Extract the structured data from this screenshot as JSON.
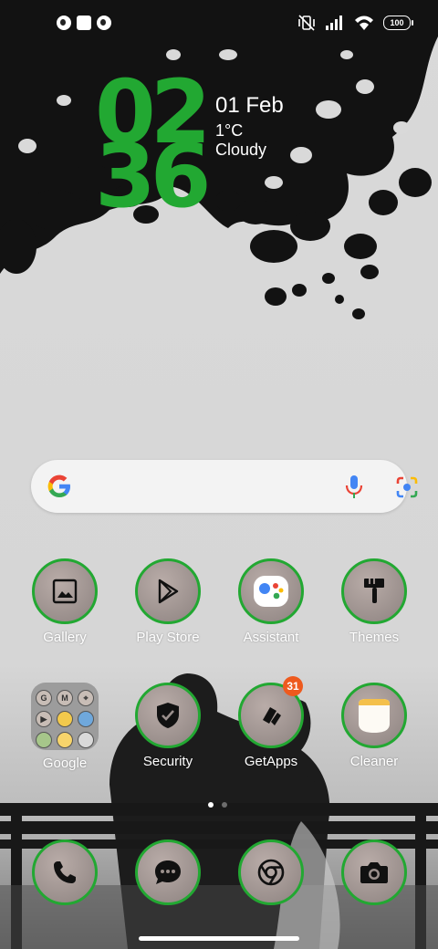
{
  "status_bar": {
    "battery": "100",
    "left_icons": [
      "app-notification-icon",
      "square-notification-icon",
      "app-notification-icon"
    ],
    "right_icons": [
      "vibrate-off-icon",
      "signal-icon",
      "wifi-icon",
      "battery-icon"
    ]
  },
  "clock": {
    "hours": "02",
    "minutes": "36",
    "date": "01 Feb",
    "temperature": "1°C",
    "weather": "Cloudy",
    "accent_color": "#22a832"
  },
  "search": {
    "icons": [
      "google-g-icon",
      "mic-icon",
      "lens-icon"
    ]
  },
  "apps_row1": [
    {
      "label": "Gallery",
      "icon": "gallery-icon"
    },
    {
      "label": "Play Store",
      "icon": "play-store-icon"
    },
    {
      "label": "Assistant",
      "icon": "assistant-icon"
    },
    {
      "label": "Themes",
      "icon": "brush-icon"
    }
  ],
  "apps_row2": [
    {
      "label": "Google",
      "icon": "folder-icon"
    },
    {
      "label": "Security",
      "icon": "shield-check-icon"
    },
    {
      "label": "GetApps",
      "icon": "getapps-icon",
      "badge": "31"
    },
    {
      "label": "Cleaner",
      "icon": "cleaner-icon"
    }
  ],
  "dock": [
    {
      "icon": "phone-icon"
    },
    {
      "icon": "messages-icon"
    },
    {
      "icon": "chrome-icon"
    },
    {
      "icon": "camera-icon"
    }
  ],
  "folder_contents": [
    "G",
    "M",
    "maps",
    "yt",
    "photos",
    "drive",
    "android",
    "keep",
    "files"
  ]
}
